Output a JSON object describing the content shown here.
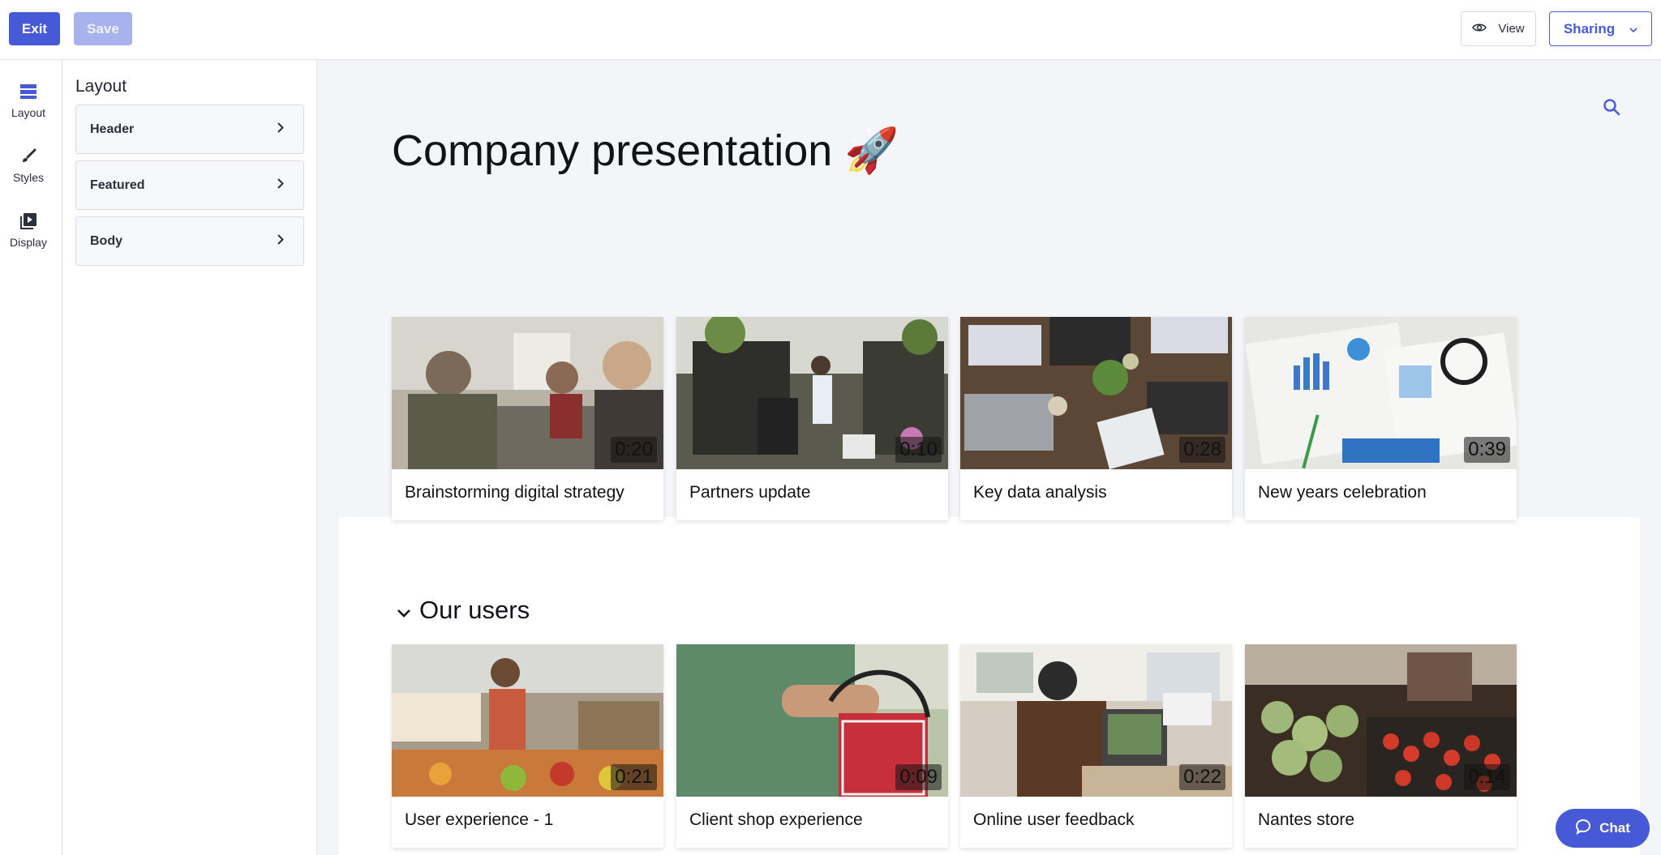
{
  "toolbar": {
    "exit_label": "Exit",
    "save_label": "Save",
    "view_label": "View",
    "sharing_label": "Sharing",
    "accent_color": "#4659d6"
  },
  "rail": {
    "items": [
      {
        "label": "Layout",
        "icon": "layout-icon"
      },
      {
        "label": "Styles",
        "icon": "brush-icon"
      },
      {
        "label": "Display",
        "icon": "video-library-icon"
      }
    ]
  },
  "panel": {
    "title": "Layout",
    "sections": [
      {
        "label": "Header"
      },
      {
        "label": "Featured"
      },
      {
        "label": "Body"
      }
    ]
  },
  "page": {
    "title": "Company presentation 🚀",
    "featured": [
      {
        "title": "Brainstorming digital strategy",
        "duration": "0:20"
      },
      {
        "title": "Partners update",
        "duration": "0:10"
      },
      {
        "title": "Key data analysis",
        "duration": "0:28"
      },
      {
        "title": "New years celebration",
        "duration": "0:39"
      }
    ],
    "section": {
      "title": "Our users",
      "videos": [
        {
          "title": "User experience - 1",
          "duration": "0:21"
        },
        {
          "title": "Client shop experience",
          "duration": "0:09"
        },
        {
          "title": "Online user feedback",
          "duration": "0:22"
        },
        {
          "title": "Nantes store",
          "duration": "0:14"
        }
      ]
    }
  },
  "chat": {
    "label": "Chat"
  }
}
